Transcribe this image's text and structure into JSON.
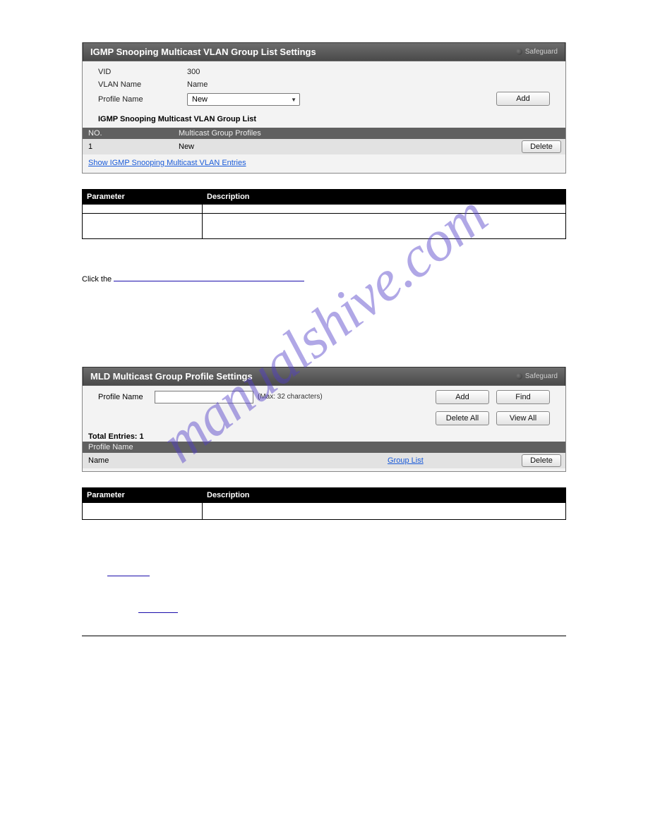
{
  "watermark": "manualshive.com",
  "panel1": {
    "title": "IGMP Snooping Multicast VLAN Group List Settings",
    "safeguard": "Safeguard",
    "vid_label": "VID",
    "vid_value": "300",
    "vlan_label": "VLAN Name",
    "vlan_value": "Name",
    "profile_label": "Profile Name",
    "profile_value": "New",
    "add_btn": "Add",
    "list_head": "IGMP Snooping Multicast VLAN Group List",
    "col_no": "NO.",
    "col_mgp": "Multicast Group Profiles",
    "row_no": "1",
    "row_mgp": "New",
    "delete_btn": "Delete",
    "show_link": "Show IGMP Snooping Multicast VLAN Entries"
  },
  "caption1": " ",
  "table1": {
    "h1": "Parameter",
    "h2": "Description",
    "r1c1": " ",
    "r1c2": " ",
    "r2c1": " ",
    "r2c2": " "
  },
  "text_row1_pre": "Click the ",
  "text_row1_link": " ",
  "text_row1_post": " ",
  "panel2": {
    "title": "MLD Multicast Group Profile Settings",
    "safeguard": "Safeguard",
    "profile_label": "Profile Name",
    "hint": "(Max: 32 characters)",
    "add_btn": "Add",
    "find_btn": "Find",
    "delall_btn": "Delete All",
    "viewall_btn": "View All",
    "total": "Total Entries: 1",
    "col_profile": "Profile Name",
    "row_profile": "Name",
    "grouplist_link": "Group List",
    "delete_btn": "Delete"
  },
  "caption2": " ",
  "table2": {
    "h1": "Parameter",
    "h2": "Description",
    "r1c1": " ",
    "r1c2": " "
  },
  "text2_pre": " ",
  "text2_link": " ",
  "text3_pre": " ",
  "text3_link": " "
}
